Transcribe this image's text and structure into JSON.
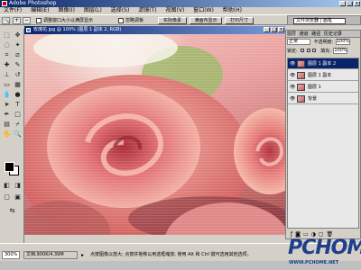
{
  "app": {
    "title": "Adobe Photoshop"
  },
  "menu": [
    "文件(F)",
    "编辑(E)",
    "图像(I)",
    "图层(L)",
    "选择(S)",
    "滤镜(T)",
    "视图(V)",
    "窗口(W)",
    "帮助(H)"
  ],
  "options": {
    "resize_windows": "调整窗口大小以满屏显示",
    "ignore_palettes": "忽略调板",
    "actual_pixels": "实际像素",
    "fit_on_screen": "满画布显示",
    "print_size": "打印尺寸"
  },
  "palette_well": {
    "tab": "文件浏览器 | 画笔"
  },
  "document": {
    "title": "玫瑰花.jpg @ 100% (图层 1 副本 2, RGB)"
  },
  "status": {
    "zoom": "300%",
    "doc_size": "文档:900K/4.39M",
    "message": "点按图像以放大; 点按并拖移以用选框缩放; 使用 Alt 和 Ctrl 键可选用其他选项。"
  },
  "layers_panel": {
    "tabs": [
      "图层",
      "通道",
      "路径",
      "历史记录"
    ],
    "active_tab": "图层",
    "blend_mode": "正常",
    "opacity_label": "不透明度:",
    "opacity": "100%",
    "lock_label": "锁定:",
    "fill_label": "填充:",
    "fill": "100%",
    "layers": [
      {
        "name": "图层 1 副本 2",
        "visible": true,
        "selected": true
      },
      {
        "name": "图层 1 副本",
        "visible": true,
        "selected": false
      },
      {
        "name": "图层 1",
        "visible": true,
        "selected": false
      },
      {
        "name": "背景",
        "visible": true,
        "selected": false
      }
    ]
  },
  "watermark": {
    "logo": "PCHOME",
    "url": "WWW.PCHOME.NET"
  },
  "icons": {
    "zoom_tool": "magnifier-icon",
    "move": "move-icon",
    "marquee": "marquee-icon",
    "lasso": "lasso-icon",
    "magic_wand": "magic-wand-icon",
    "crop": "crop-icon",
    "brush": "brush-icon",
    "eye": "eye-icon"
  }
}
